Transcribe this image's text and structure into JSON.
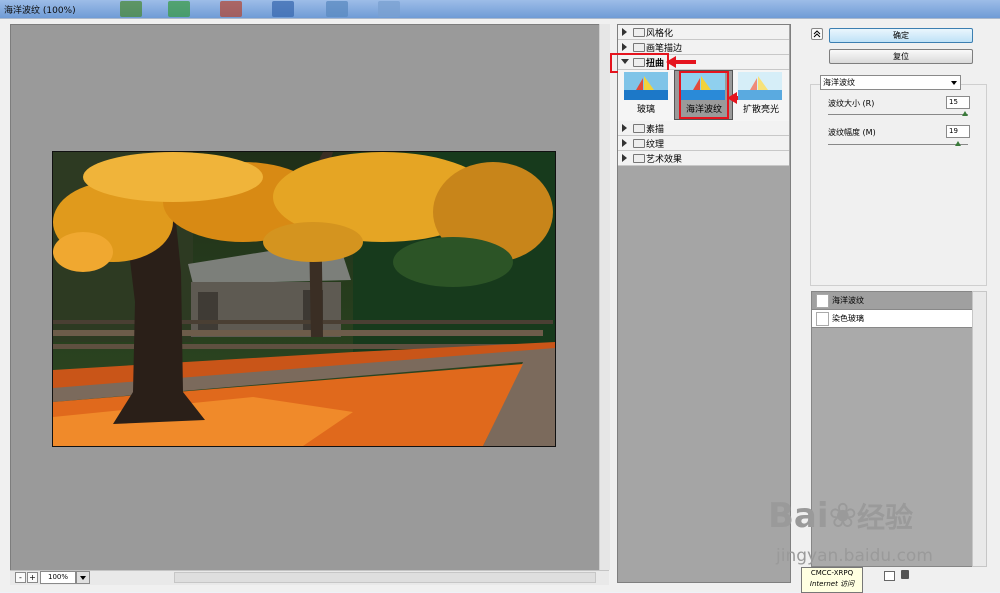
{
  "window": {
    "title": "海洋波纹 (100%)"
  },
  "preview": {
    "zoom": "100%",
    "zoom_out": "-",
    "zoom_in": "+"
  },
  "filter_tree": {
    "categories": [
      {
        "label": "风格化",
        "expanded": false
      },
      {
        "label": "画笔描边",
        "expanded": false
      },
      {
        "label": "扭曲",
        "expanded": true
      },
      {
        "label": "素描",
        "expanded": false
      },
      {
        "label": "纹理",
        "expanded": false
      },
      {
        "label": "艺术效果",
        "expanded": false
      }
    ],
    "distort_thumbnails": [
      {
        "label": "玻璃",
        "selected": false
      },
      {
        "label": "海洋波纹",
        "selected": true
      },
      {
        "label": "扩散亮光",
        "selected": false
      }
    ]
  },
  "buttons": {
    "ok": "确定",
    "reset": "复位"
  },
  "filter_select": {
    "value": "海洋波纹"
  },
  "params": [
    {
      "label": "波纹大小 (R)",
      "value": "15",
      "level": 1.0
    },
    {
      "label": "波纹幅度 (M)",
      "value": "19",
      "level": 0.95
    }
  ],
  "effect_layers": [
    {
      "label": "海洋波纹",
      "selected": true
    },
    {
      "label": "染色玻璃",
      "selected": false
    }
  ],
  "tooltip": {
    "line1": "CMCC-XRPQ",
    "line2": "Internet 访问"
  },
  "watermark": {
    "brand": "Bai",
    "brand2": "经验",
    "url": "jingyan.baidu.com"
  },
  "colors": {
    "highlight": "#e5141e",
    "ok_button": "#bfe2f7",
    "selected_layer": "#a0a0a0"
  }
}
